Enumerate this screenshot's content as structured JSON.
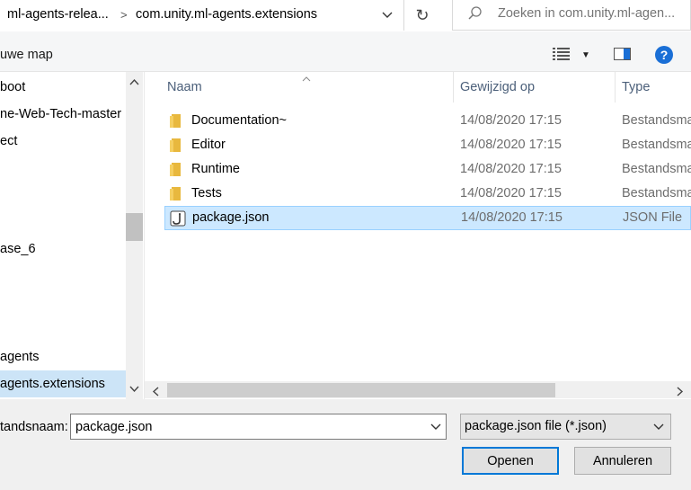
{
  "address": {
    "crumbs": [
      "ml-agents-relea...",
      "com.unity.ml-agents.extensions"
    ],
    "separator": ">"
  },
  "search": {
    "placeholder": "Zoeken in com.unity.ml-agen..."
  },
  "toolbar": {
    "new_folder_label": "uwe map"
  },
  "nav": {
    "items": [
      {
        "label": "boot"
      },
      {
        "label": "ne-Web-Tech-master"
      },
      {
        "label": "ect"
      },
      {
        "label": "ase_6"
      },
      {
        "label": "agents"
      },
      {
        "label": "agents.extensions"
      }
    ]
  },
  "columns": {
    "name": "Naam",
    "modified": "Gewijzigd op",
    "type": "Type"
  },
  "files": [
    {
      "name": "Documentation~",
      "modified": "14/08/2020 17:15",
      "type": "Bestandsmap",
      "icon": "folder-icon"
    },
    {
      "name": "Editor",
      "modified": "14/08/2020 17:15",
      "type": "Bestandsmap",
      "icon": "folder-icon"
    },
    {
      "name": "Runtime",
      "modified": "14/08/2020 17:15",
      "type": "Bestandsmap",
      "icon": "folder-icon"
    },
    {
      "name": "Tests",
      "modified": "14/08/2020 17:15",
      "type": "Bestandsmap",
      "icon": "folder-icon"
    },
    {
      "name": "package.json",
      "modified": "14/08/2020 17:15",
      "type": "JSON File",
      "icon": "json-file-icon"
    }
  ],
  "bottom": {
    "filename_label": "tandsnaam:",
    "filename_value": "package.json",
    "filter_value": "package.json file (*.json)",
    "open_label": "Openen",
    "cancel_label": "Annuleren"
  },
  "colors": {
    "selection": "#cce8ff",
    "accent": "#0078d7",
    "folder": "#e8b83e"
  }
}
